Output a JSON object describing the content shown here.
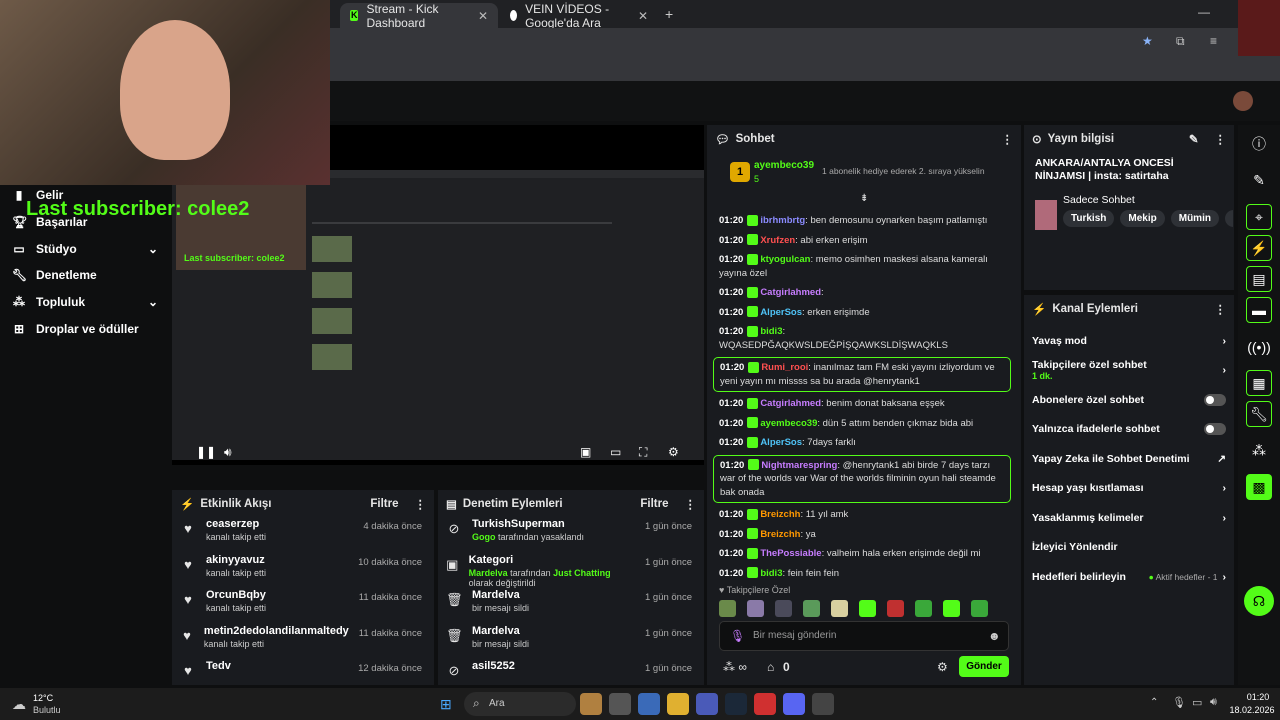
{
  "browser": {
    "tabs": [
      {
        "label": "Stream - Kick Dashboard",
        "active": true
      },
      {
        "label": "VEIN VİDEOS - Google'da Ara",
        "active": false
      }
    ]
  },
  "nav": {
    "items": [
      {
        "label": "Gelir",
        "icon": "chart-icon"
      },
      {
        "label": "Başarılar",
        "icon": "trophy-icon"
      },
      {
        "label": "Stüdyo",
        "icon": "monitor-icon",
        "chevron": true
      },
      {
        "label": "Denetleme",
        "icon": "wrench-icon"
      },
      {
        "label": "Topluluk",
        "icon": "people-icon",
        "chevron": true
      },
      {
        "label": "Droplar ve ödüller",
        "icon": "gift-icon"
      }
    ]
  },
  "overlay": {
    "subscriber": "Last subscriber: colee2",
    "subscriber_small": "Last subscriber: colee2"
  },
  "events": {
    "title": "Etkinlik Akışı",
    "filter": "Filtre",
    "rows": [
      {
        "name": "ceaserzep",
        "desc": "kanalı takip etti",
        "time": "4 dakika önce"
      },
      {
        "name": "akinyyavuz",
        "desc": "kanalı takip etti",
        "time": "10 dakika önce"
      },
      {
        "name": "OrcunBqby",
        "desc": "kanalı takip etti",
        "time": "11 dakika önce"
      },
      {
        "name": "metin2dedolandilanmaltedy",
        "desc": "kanalı takip etti",
        "time": "11 dakika önce"
      },
      {
        "name": "Tedv",
        "desc": "",
        "time": "12 dakika önce"
      }
    ]
  },
  "mod": {
    "title": "Denetim Eylemleri",
    "filter": "Filtre",
    "rows": [
      {
        "name": "TurkishSuperman",
        "pre": "Gogo",
        "desc": " tarafından yasaklandı",
        "time": "1 gün önce"
      },
      {
        "name": "Kategori",
        "pre": "Mardelva",
        "desc": " tarafından ",
        "post": "Just Chatting",
        "tail": " olarak değiştirildi",
        "time": "1 gün önce"
      },
      {
        "name": "Mardelva",
        "desc": "bir mesajı sildi",
        "time": "1 gün önce"
      },
      {
        "name": "Mardelva",
        "desc": "bir mesajı sildi",
        "time": "1 gün önce"
      },
      {
        "name": "asil5252",
        "desc": "",
        "time": "1 gün önce"
      }
    ]
  },
  "chat": {
    "title": "Sohbet",
    "pinned_user": "ayembeco39",
    "pinned_count": "5",
    "pinned_text": "1 abonelik hediye ederek 2. sıraya yükselin",
    "messages": [
      {
        "t": "01:20",
        "u": "ibrhmbrtg",
        "c": "#8b8bff",
        "m": ": ben demosunu oynarken başım patlamıştı"
      },
      {
        "t": "01:20",
        "u": "Xrufzen",
        "c": "#ff5050",
        "m": ": abi erken erişim"
      },
      {
        "t": "01:20",
        "u": "ktyogulcan",
        "c": "#53fc18",
        "m": ": memo osimhen maskesi alsana kameralı yayına özel"
      },
      {
        "t": "01:20",
        "u": "Catgirlahmed",
        "c": "#c77dff",
        "m": ":"
      },
      {
        "t": "01:20",
        "u": "AlperSos",
        "c": "#4fc3f7",
        "m": ": erken erişimde"
      },
      {
        "t": "01:20",
        "u": "bidi3",
        "c": "#53fc18",
        "m": ": WQASEDPĞAQKWSLDEĞPİŞQAWKSLDİŞWAQKLS"
      },
      {
        "t": "01:20",
        "u": "Rumi_rooi",
        "c": "#ff5050",
        "m": ": inanılmaz tam FM eski yayını izliyordum ve yeni yayın mı missss sa bu arada @henrytank1",
        "hl": true
      },
      {
        "t": "01:20",
        "u": "Catgirlahmed",
        "c": "#c77dff",
        "m": ": benim donat baksana eşşek"
      },
      {
        "t": "01:20",
        "u": "ayembeco39",
        "c": "#53fc18",
        "m": ": dün 5 attım benden çıkmaz bida abi"
      },
      {
        "t": "01:20",
        "u": "AlperSos",
        "c": "#4fc3f7",
        "m": ": 7days farklı"
      },
      {
        "t": "01:20",
        "u": "Nightmarespring",
        "c": "#c77dff",
        "m": ": @henrytank1 abi birde 7 days tarzı war of the worlds var War of the worlds filminin oyun hali steamde bak onada",
        "hl": true
      },
      {
        "t": "01:20",
        "u": "Breizchh",
        "c": "#ff9800",
        "m": ": 11 yıl amk"
      },
      {
        "t": "01:20",
        "u": "Breizchh",
        "c": "#ff9800",
        "m": ": ya"
      },
      {
        "t": "01:20",
        "u": "ThePossiable",
        "c": "#c77dff",
        "m": ": valheim hala erken erişimde değil mi"
      },
      {
        "t": "01:20",
        "u": "bidi3",
        "c": "#53fc18",
        "m": ": fein fein fein"
      }
    ],
    "emote_label": "Takipçilere Özel",
    "placeholder": "Bir mesaj gönderin",
    "count": "0",
    "send": "Gönder"
  },
  "info": {
    "title": "Yayın bilgisi",
    "stream_title": "ANKARA/ANTALYA ONCESİ NİNJAMSI | insta: satirtaha",
    "chat_mode": "Sadece Sohbet",
    "tags": [
      "Turkish",
      "Mekip",
      "Mümin",
      "Müs"
    ]
  },
  "actions": {
    "title": "Kanal Eylemleri",
    "rows": [
      {
        "label": "Yavaş mod",
        "kind": "chev"
      },
      {
        "label": "Takipçilere özel sohbet",
        "sub": "1 dk.",
        "kind": "chev"
      },
      {
        "label": "Abonelere özel sohbet",
        "kind": "toggle"
      },
      {
        "label": "Yalnızca ifadelerle sohbet",
        "kind": "toggle"
      },
      {
        "label": "Yapay Zeka ile Sohbet Denetimi",
        "kind": "ext"
      },
      {
        "label": "Hesap yaşı kısıtlaması",
        "kind": "chev"
      },
      {
        "label": "Yasaklanmış kelimeler",
        "kind": "chev"
      },
      {
        "label": "İzleyici Yönlendir",
        "kind": "none"
      },
      {
        "label": "Hedefleri belirleyin",
        "kind": "goal",
        "goal": "Aktif hedefler - 1"
      }
    ]
  },
  "taskbar": {
    "temp": "12°C",
    "weather": "Bulutlu",
    "search": "Ara",
    "time": "01:20",
    "date": "18.02.2026"
  }
}
